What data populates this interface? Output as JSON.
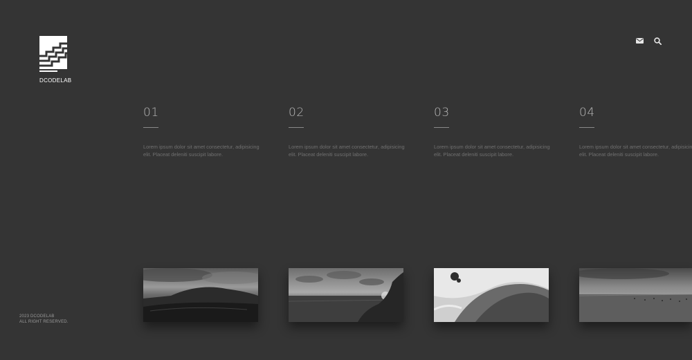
{
  "brand": {
    "name": "DCODELAB",
    "logo_icon": "stairs-logo-icon"
  },
  "header": {
    "icons": [
      "mail-icon",
      "search-icon"
    ]
  },
  "items": [
    {
      "number": "01",
      "description": "Lorem ipsum dolor sit amet consectetur, adipisicing elit. Placeat deleniti suscipit labore.",
      "image": "ocean-wave-dark-clouds"
    },
    {
      "number": "02",
      "description": "Lorem ipsum dolor sit amet consectetur, adipisicing elit. Placeat deleniti suscipit labore.",
      "image": "sea-horizon-sunset-rocks"
    },
    {
      "number": "03",
      "description": "Lorem ipsum dolor sit amet consectetur, adipisicing elit. Placeat deleniti suscipit labore.",
      "image": "crashing-wave-foam"
    },
    {
      "number": "04",
      "description": "Lorem ipsum dolor sit amet consectetur, adipisicing elit. Placeat deleniti suscipit labore.",
      "image": "calm-sea-birds"
    }
  ],
  "footer": {
    "line1": "2023 DCODELAB",
    "line2": "ALL RIGHT RESERVED."
  }
}
